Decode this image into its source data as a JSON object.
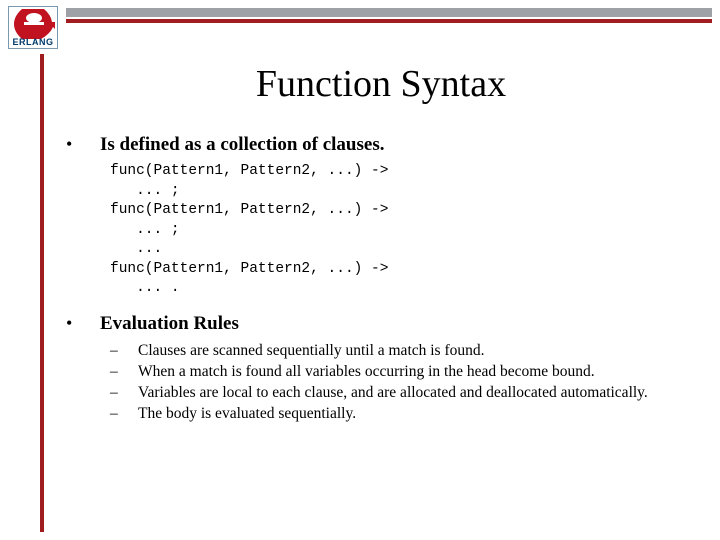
{
  "logo": {
    "label": "ERLANG"
  },
  "title": "Function Syntax",
  "section1": {
    "heading": "Is defined as a collection of clauses.",
    "code": "func(Pattern1, Pattern2, ...) ->\n   ... ;\nfunc(Pattern1, Pattern2, ...) ->\n   ... ;\n   ...\nfunc(Pattern1, Pattern2, ...) ->\n   ... ."
  },
  "section2": {
    "heading": "Evaluation Rules",
    "items": [
      "Clauses are scanned sequentially until a match is found.",
      "When a match is found all variables occurring in the head become bound.",
      "Variables are local to each clause, and are allocated and deallocated automatically.",
      "The body is evaluated sequentially."
    ]
  }
}
